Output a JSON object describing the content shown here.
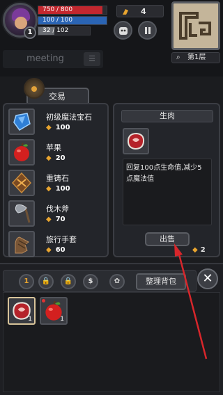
{
  "player": {
    "level": "1",
    "hp_text": "750 / 800",
    "hp_fraction": 0.9375,
    "mp_text": "100 / 100",
    "mp_fraction": 1.0,
    "xp_text": "32 / 102",
    "xp_fraction": 0.31
  },
  "currency": {
    "gold": "4"
  },
  "floor": {
    "label": "第1层"
  },
  "chat": {
    "placeholder": "meeting"
  },
  "trade": {
    "title": "交易",
    "items": [
      {
        "name": "初级魔法宝石",
        "price": "100",
        "icon": "gem-icon"
      },
      {
        "name": "苹果",
        "price": "20",
        "icon": "apple-icon"
      },
      {
        "name": "重铸石",
        "price": "100",
        "icon": "reforge-stone-icon"
      },
      {
        "name": "伐木斧",
        "price": "70",
        "icon": "axe-icon"
      },
      {
        "name": "旅行手套",
        "price": "60",
        "icon": "glove-icon"
      }
    ]
  },
  "detail": {
    "title": "生肉",
    "description": "回复100点生命值,减少5点魔法值",
    "sell_label": "出售",
    "sell_price": "2",
    "icon": "raw-meat-icon"
  },
  "bag": {
    "toolbar": {
      "page_label": "1",
      "sort_label": "整理背包"
    },
    "items": [
      {
        "icon": "raw-meat-icon",
        "count": "1"
      },
      {
        "icon": "apple-icon",
        "count": "1"
      }
    ]
  },
  "colors": {
    "hp": "#c3272e",
    "mp": "#2a64b4",
    "gold": "#e9a52f",
    "arrow": "#d8262b"
  }
}
